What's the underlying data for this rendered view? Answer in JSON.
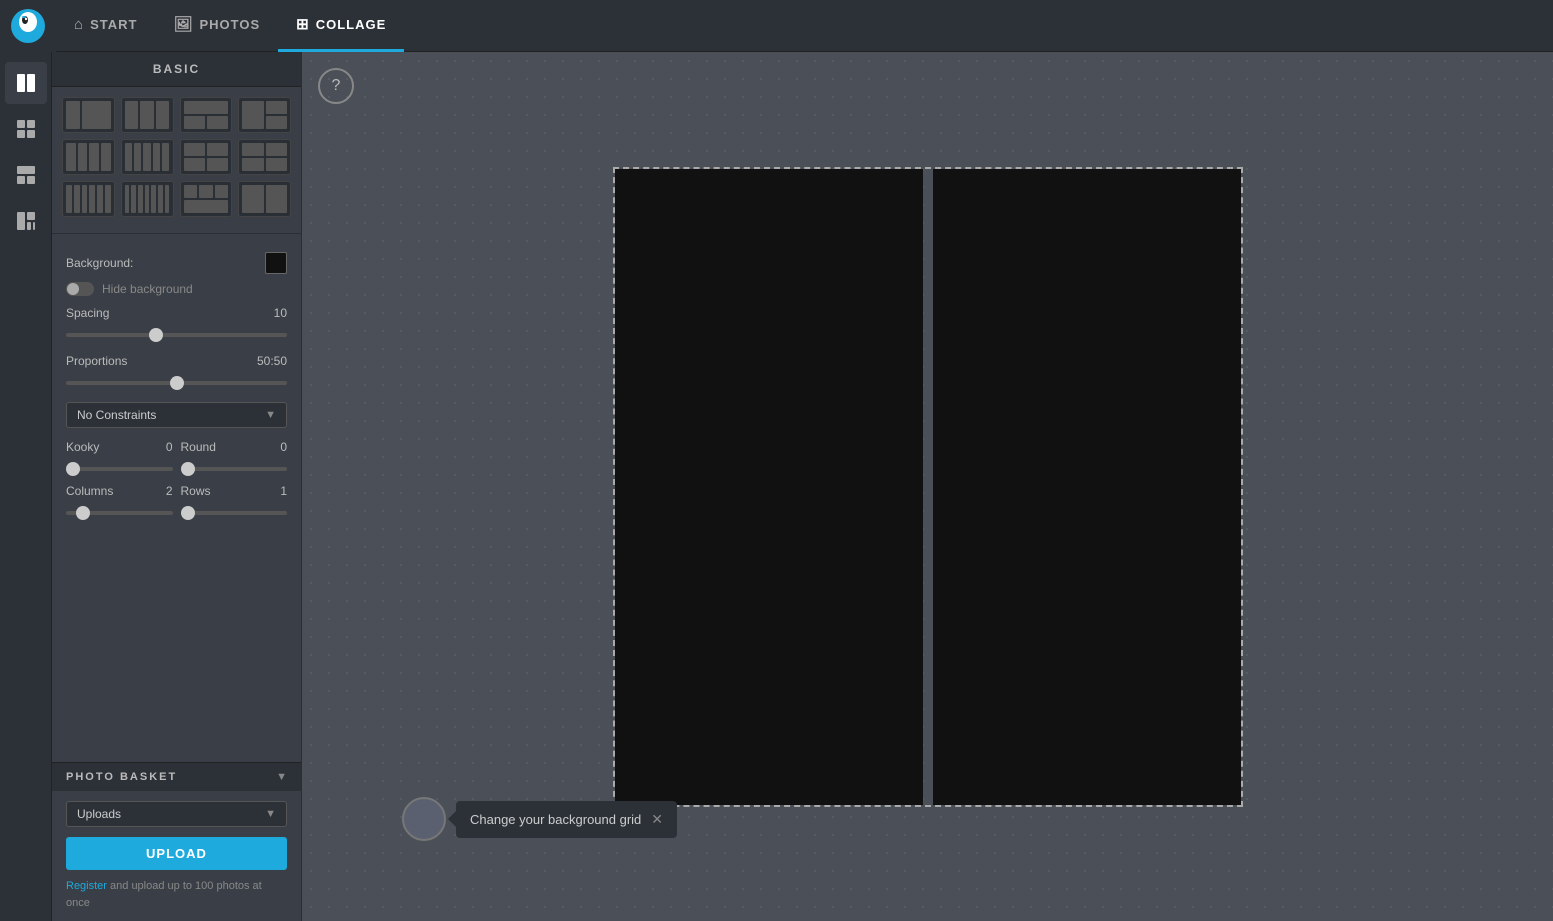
{
  "app": {
    "logo_alt": "Fotor Logo"
  },
  "top_nav": {
    "items": [
      {
        "id": "start",
        "label": "START",
        "icon": "home",
        "active": false
      },
      {
        "id": "photos",
        "label": "PHOTOS",
        "icon": "image",
        "active": false
      },
      {
        "id": "collage",
        "label": "COLLAGE",
        "icon": "grid",
        "active": true
      }
    ]
  },
  "icon_bar": {
    "items": [
      {
        "id": "layout",
        "icon": "layout",
        "active": true
      },
      {
        "id": "grid",
        "icon": "grid",
        "active": false
      },
      {
        "id": "panels",
        "icon": "panels",
        "active": false
      },
      {
        "id": "funky",
        "icon": "funky",
        "active": false
      }
    ]
  },
  "panel": {
    "header": "BASIC",
    "background_label": "Background:",
    "background_color": "#111111",
    "hide_background_label": "Hide background",
    "spacing_label": "Spacing",
    "spacing_value": "10",
    "spacing_min": 0,
    "spacing_max": 50,
    "spacing_current": 20,
    "proportions_label": "Proportions",
    "proportions_value": "50:50",
    "proportions_min": 0,
    "proportions_max": 100,
    "proportions_current": 50,
    "constraint_dropdown": {
      "label": "No Constraints",
      "arrow": "▼"
    },
    "kooky_label": "Kooky",
    "kooky_value": "0",
    "kooky_min": 0,
    "kooky_max": 100,
    "kooky_current": 0,
    "round_label": "Round",
    "round_value": "0",
    "round_min": 0,
    "round_max": 100,
    "round_current": 0,
    "columns_label": "Columns",
    "columns_value": "2",
    "columns_min": 1,
    "columns_max": 10,
    "columns_current": 18,
    "rows_label": "Rows",
    "rows_value": "1",
    "rows_min": 1,
    "rows_max": 10,
    "rows_current": 9
  },
  "photo_basket": {
    "title": "PHOTO BASKET",
    "arrow": "▼",
    "source_dropdown": {
      "label": "Uploads",
      "arrow": "▼"
    },
    "upload_button": "UPLOAD",
    "register_text": "Register and upload up to 100 photos at once",
    "register_link": "Register"
  },
  "help": {
    "label": "?"
  },
  "notification": {
    "message": "Change your background grid",
    "close": "✕"
  },
  "canvas": {
    "panels": [
      {
        "id": "left"
      },
      {
        "id": "right"
      }
    ]
  },
  "collage_thumbs": [
    [
      {
        "cols": [
          1,
          2
        ]
      },
      {
        "cols": [
          1,
          1,
          1
        ]
      },
      {
        "cols": [
          0.5,
          1,
          0.5
        ]
      },
      {
        "cols": [
          1,
          0.5,
          1
        ]
      }
    ],
    [
      {
        "cols": [
          1,
          1,
          1,
          1
        ]
      },
      {
        "cols": [
          1,
          1,
          1,
          1,
          1
        ]
      },
      {
        "cols": [
          0.5,
          1,
          0.5,
          0.5
        ]
      },
      {
        "cols": [
          1,
          0.5,
          1,
          0.5
        ]
      }
    ],
    [
      {
        "cols": [
          1,
          1,
          1,
          1,
          1,
          1
        ]
      },
      {
        "cols": [
          1,
          1,
          1,
          1,
          1,
          1,
          1
        ]
      },
      {
        "cols": [
          0.5,
          0.5,
          0.5,
          0.5
        ]
      },
      {
        "cols": [
          2,
          2
        ]
      }
    ]
  ]
}
